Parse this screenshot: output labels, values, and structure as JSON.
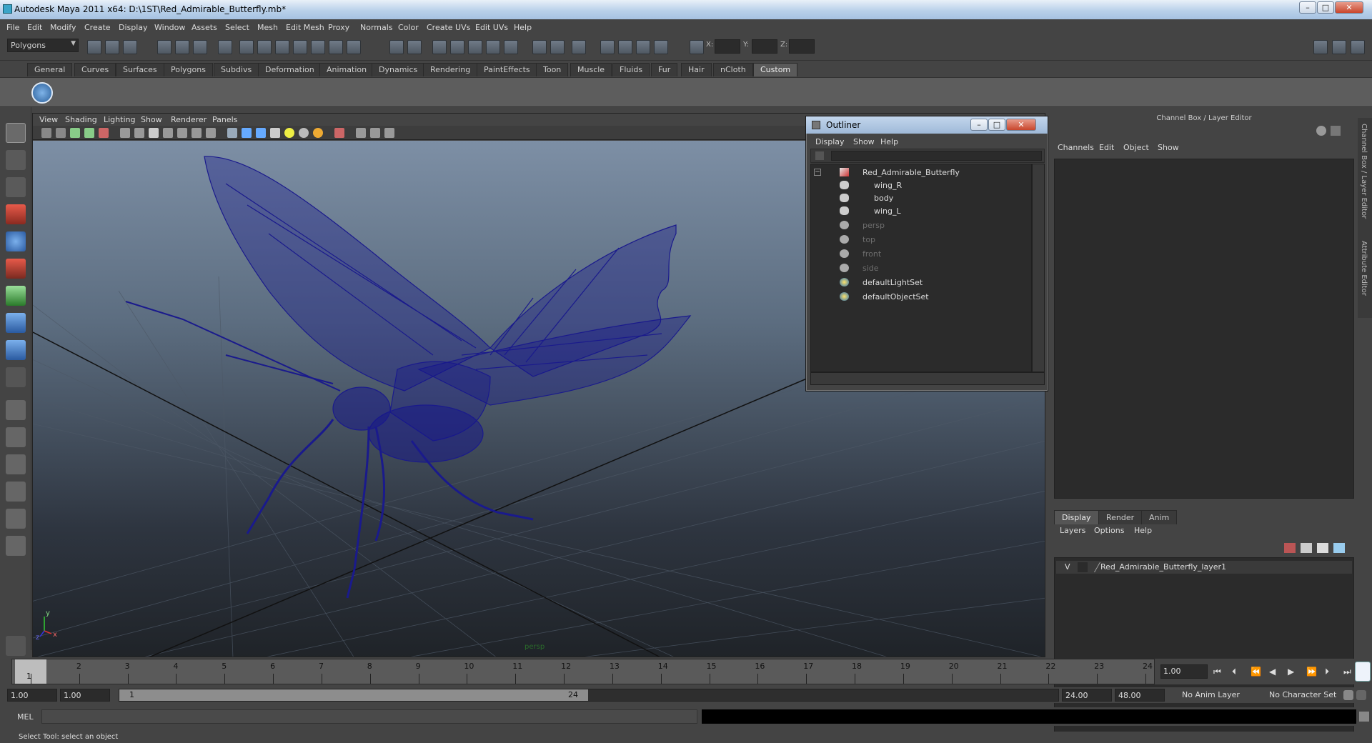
{
  "window": {
    "title": "Autodesk Maya 2011 x64: D:\\1ST\\Red_Admirable_Butterfly.mb*"
  },
  "main_menu": [
    "File",
    "Edit",
    "Modify",
    "Create",
    "Display",
    "Window",
    "Assets",
    "Select",
    "Mesh",
    "Edit Mesh",
    "Proxy",
    "Normals",
    "Color",
    "Create UVs",
    "Edit UVs",
    "Help"
  ],
  "status_line": {
    "menu_set": "Polygons",
    "coord_labels": [
      "X:",
      "Y:",
      "Z:"
    ]
  },
  "shelf": {
    "tabs": [
      "General",
      "Curves",
      "Surfaces",
      "Polygons",
      "Subdivs",
      "Deformation",
      "Animation",
      "Dynamics",
      "Rendering",
      "PaintEffects",
      "Toon",
      "Muscle",
      "Fluids",
      "Fur",
      "Hair",
      "nCloth",
      "Custom"
    ],
    "active_tab": "Custom"
  },
  "viewport": {
    "menu": [
      "View",
      "Shading",
      "Lighting",
      "Show",
      "Renderer",
      "Panels"
    ],
    "camera_label": "persp",
    "axis_labels": {
      "y": "y",
      "x": "x",
      "z": "z"
    },
    "wire_color": "#1a1a8c"
  },
  "outliner": {
    "title": "Outliner",
    "menu": [
      "Display",
      "Show",
      "Help"
    ],
    "items": [
      {
        "label": "Red_Admirable_Butterfly",
        "dim": false,
        "icon": "transform-icon"
      },
      {
        "label": "wing_R",
        "dim": false,
        "icon": "mesh-icon"
      },
      {
        "label": "body",
        "dim": false,
        "icon": "mesh-icon"
      },
      {
        "label": "wing_L",
        "dim": false,
        "icon": "mesh-icon"
      },
      {
        "label": "persp",
        "dim": true,
        "icon": "camera-icon"
      },
      {
        "label": "top",
        "dim": true,
        "icon": "camera-icon"
      },
      {
        "label": "front",
        "dim": true,
        "icon": "camera-icon"
      },
      {
        "label": "side",
        "dim": true,
        "icon": "camera-icon"
      },
      {
        "label": "defaultLightSet",
        "dim": false,
        "icon": "set-icon"
      },
      {
        "label": "defaultObjectSet",
        "dim": false,
        "icon": "set-icon"
      }
    ]
  },
  "channel_box": {
    "header": "Channel Box / Layer Editor",
    "menu": [
      "Channels",
      "Edit",
      "Object",
      "Show"
    ],
    "side_tabs": [
      "Channel Box / Layer Editor",
      "Attribute Editor"
    ]
  },
  "layer_editor": {
    "tabs": [
      "Display",
      "Render",
      "Anim"
    ],
    "active_tab": "Display",
    "menu": [
      "Layers",
      "Options",
      "Help"
    ],
    "layer": {
      "visible_flag": "V",
      "name": "Red_Admirable_Butterfly_layer1"
    }
  },
  "time_slider": {
    "start": 1,
    "end": 24,
    "current_frame": "1",
    "ticks": [
      "1",
      "2",
      "3",
      "4",
      "5",
      "6",
      "7",
      "8",
      "9",
      "10",
      "11",
      "12",
      "13",
      "14",
      "15",
      "16",
      "17",
      "18",
      "19",
      "20",
      "21",
      "22",
      "23",
      "24"
    ],
    "current_time_field": "1.00"
  },
  "range_slider": {
    "start_time": "1.00",
    "playback_start": "1.00",
    "range_start": "1",
    "range_end": "24",
    "playback_end": "24.00",
    "end_time": "48.00",
    "anim_layer": "No Anim Layer",
    "character_set": "No Character Set"
  },
  "command_line": {
    "label": "MEL"
  },
  "help_line": {
    "text": "Select Tool: select an object"
  }
}
